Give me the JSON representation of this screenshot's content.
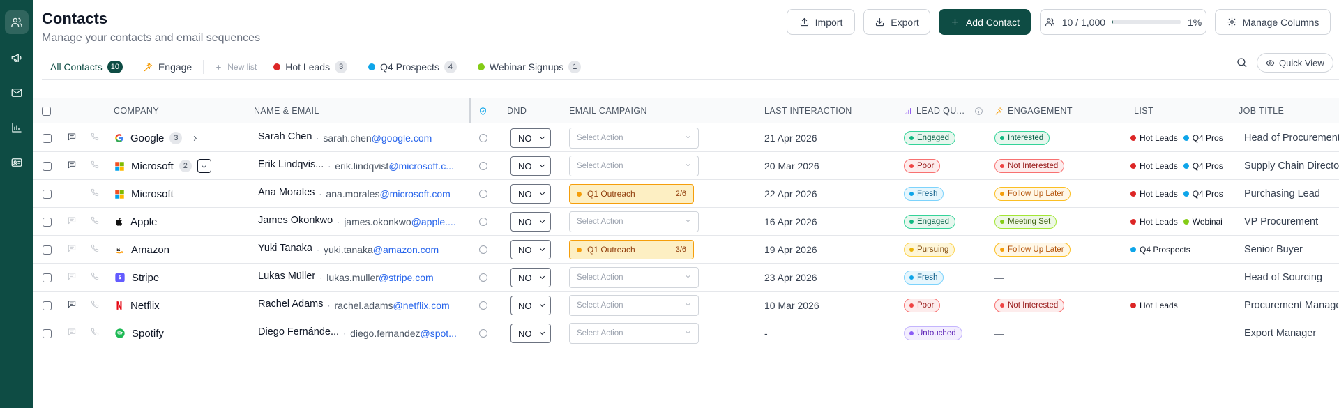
{
  "sidebar": {
    "items": [
      {
        "name": "contacts",
        "icon": "users-icon"
      },
      {
        "name": "campaigns",
        "icon": "megaphone-icon"
      },
      {
        "name": "email",
        "icon": "mail-icon"
      },
      {
        "name": "analytics",
        "icon": "bar-chart-icon"
      },
      {
        "name": "templates",
        "icon": "id-card-icon"
      }
    ],
    "colors": {
      "background": "#0e4c44"
    }
  },
  "header": {
    "title": "Contacts",
    "subtitle": "Manage your contacts and email sequences",
    "import_label": "Import",
    "export_label": "Export",
    "add_contact_label": "Add Contact",
    "usage_label": "10 / 1,000",
    "usage_percent_label": "1%",
    "usage_fraction": 0.01,
    "manage_columns_label": "Manage Columns"
  },
  "tabs": {
    "all_contacts": {
      "label": "All Contacts",
      "count": "10"
    },
    "engage": {
      "label": "Engage"
    },
    "new_list": {
      "label": "New list"
    },
    "lists": [
      {
        "label": "Hot Leads",
        "count": "3",
        "color": "#dc2626"
      },
      {
        "label": "Q4 Prospects",
        "count": "4",
        "color": "#0ea5e9"
      },
      {
        "label": "Webinar Signups",
        "count": "1",
        "color": "#84cc16"
      }
    ]
  },
  "toolbar": {
    "quick_view_label": "Quick View"
  },
  "table": {
    "headers": {
      "company": "COMPANY",
      "name_email": "NAME & EMAIL",
      "dnd": "DND",
      "email_campaign": "EMAIL CAMPAIGN",
      "last_interaction": "LAST INTERACTION",
      "lead_quality": "LEAD QU...",
      "engagement": "ENGAGEMENT",
      "list": "LIST",
      "job_title": "JOB TITLE"
    },
    "rows": [
      {
        "company": "Google",
        "logo": "google",
        "count": "3",
        "expander": "right",
        "note_active": true,
        "name": "Sarah Chen",
        "email_user": "sarah.chen",
        "email_domain": "@google.com",
        "dnd": "NO",
        "campaign": {
          "type": "select",
          "label": "Select Action"
        },
        "last_interaction": "21 Apr 2026",
        "lead_quality": "Engaged",
        "engagement": "Interested",
        "lists": [
          {
            "label": "Hot Leads",
            "color": "#dc2626"
          },
          {
            "label": "Q4 Pros",
            "color": "#0ea5e9"
          }
        ],
        "job_title": "Head of Procurement"
      },
      {
        "company": "Microsoft",
        "logo": "microsoft",
        "count": "2",
        "expander": "down",
        "note_active": true,
        "name": "Erik Lindqvis...",
        "email_user": "erik.lindqvist",
        "email_domain": "@microsoft.c...",
        "dnd": "NO",
        "campaign": {
          "type": "select",
          "label": "Select Action"
        },
        "last_interaction": "20 Mar 2026",
        "lead_quality": "Poor",
        "engagement": "Not Interested",
        "lists": [
          {
            "label": "Hot Leads",
            "color": "#dc2626"
          },
          {
            "label": "Q4 Pros",
            "color": "#0ea5e9"
          }
        ],
        "job_title": "Supply Chain Director"
      },
      {
        "company": "Microsoft",
        "logo": "microsoft",
        "count": "",
        "expander": "",
        "note_active": false,
        "note_hidden": true,
        "name": "Ana Morales",
        "email_user": "ana.morales",
        "email_domain": "@microsoft.com",
        "dnd": "NO",
        "campaign": {
          "type": "chip",
          "label": "Q1 Outreach",
          "progress": "2/6"
        },
        "last_interaction": "22 Apr 2026",
        "lead_quality": "Fresh",
        "engagement": "Follow Up Later",
        "lists": [
          {
            "label": "Hot Leads",
            "color": "#dc2626"
          },
          {
            "label": "Q4 Pros",
            "color": "#0ea5e9"
          }
        ],
        "job_title": "Purchasing Lead"
      },
      {
        "company": "Apple",
        "logo": "apple",
        "count": "",
        "expander": "",
        "note_active": false,
        "name": "James Okonkwo",
        "email_user": "james.okonkwo",
        "email_domain": "@apple....",
        "dnd": "NO",
        "campaign": {
          "type": "select",
          "label": "Select Action"
        },
        "last_interaction": "16 Apr 2026",
        "lead_quality": "Engaged",
        "engagement": "Meeting Set",
        "lists": [
          {
            "label": "Hot Leads",
            "color": "#dc2626"
          },
          {
            "label": "Webinai",
            "color": "#84cc16"
          }
        ],
        "job_title": "VP Procurement"
      },
      {
        "company": "Amazon",
        "logo": "amazon",
        "count": "",
        "expander": "",
        "note_active": false,
        "name": "Yuki Tanaka",
        "email_user": "yuki.tanaka",
        "email_domain": "@amazon.com",
        "dnd": "NO",
        "campaign": {
          "type": "chip",
          "label": "Q1 Outreach",
          "progress": "3/6"
        },
        "last_interaction": "19 Apr 2026",
        "lead_quality": "Pursuing",
        "engagement": "Follow Up Later",
        "lists": [
          {
            "label": "Q4 Prospects",
            "color": "#0ea5e9"
          }
        ],
        "job_title": "Senior Buyer"
      },
      {
        "company": "Stripe",
        "logo": "stripe",
        "count": "",
        "expander": "",
        "note_active": false,
        "name": "Lukas Müller",
        "email_user": "lukas.muller",
        "email_domain": "@stripe.com",
        "dnd": "NO",
        "campaign": {
          "type": "select",
          "label": "Select Action"
        },
        "last_interaction": "23 Apr 2026",
        "lead_quality": "Fresh",
        "engagement": "—",
        "lists": [],
        "job_title": "Head of Sourcing"
      },
      {
        "company": "Netflix",
        "logo": "netflix",
        "count": "",
        "expander": "",
        "note_active": true,
        "name": "Rachel Adams",
        "email_user": "rachel.adams",
        "email_domain": "@netflix.com",
        "dnd": "NO",
        "campaign": {
          "type": "select",
          "label": "Select Action"
        },
        "last_interaction": "10 Mar 2026",
        "lead_quality": "Poor",
        "engagement": "Not Interested",
        "lists": [
          {
            "label": "Hot Leads",
            "color": "#dc2626"
          }
        ],
        "job_title": "Procurement Manager"
      },
      {
        "company": "Spotify",
        "logo": "spotify",
        "count": "",
        "expander": "",
        "note_active": false,
        "name": "Diego Fernánde...",
        "email_user": "diego.fernandez",
        "email_domain": "@spot...",
        "dnd": "NO",
        "campaign": {
          "type": "select",
          "label": "Select Action"
        },
        "last_interaction": "-",
        "lead_quality": "Untouched",
        "engagement": "—",
        "lists": [],
        "job_title": "Export Manager"
      }
    ]
  },
  "status_colors": {
    "Engaged": {
      "bg": "#e7f7ee",
      "border": "#34d399",
      "text": "#065f46",
      "dot": "#10b981"
    },
    "Poor": {
      "bg": "#fdecec",
      "border": "#f87171",
      "text": "#991b1b",
      "dot": "#ef4444"
    },
    "Fresh": {
      "bg": "#e6f6fd",
      "border": "#7dd3fc",
      "text": "#075985",
      "dot": "#0ea5e9"
    },
    "Pursuing": {
      "bg": "#fef6d8",
      "border": "#fcd34d",
      "text": "#854d0e",
      "dot": "#eab308"
    },
    "Untouched": {
      "bg": "#f3eefe",
      "border": "#c4b5fd",
      "text": "#5b21b6",
      "dot": "#8b5cf6"
    },
    "Interested": {
      "bg": "#e7f7ee",
      "border": "#34d399",
      "text": "#065f46",
      "dot": "#10b981"
    },
    "Not Interested": {
      "bg": "#fdecec",
      "border": "#f87171",
      "text": "#991b1b",
      "dot": "#ef4444"
    },
    "Follow Up Later": {
      "bg": "#fff7e6",
      "border": "#fbbf24",
      "text": "#b45309",
      "dot": "#f59e0b"
    },
    "Meeting Set": {
      "bg": "#eef8e6",
      "border": "#a3e635",
      "text": "#3f6212",
      "dot": "#84cc16"
    }
  }
}
